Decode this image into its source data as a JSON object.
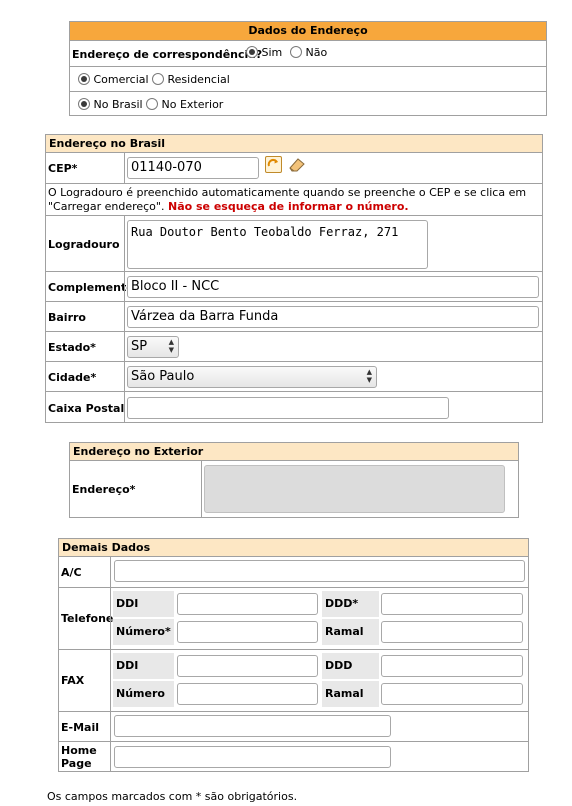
{
  "dados_endereco": {
    "title": "Dados do Endereço",
    "correspondencia_label": "Endereço de correspondência?",
    "sim": "Sim",
    "nao": "Não",
    "comercial": "Comercial",
    "residencial": "Residencial",
    "no_brasil": "No Brasil",
    "no_exterior": "No Exterior"
  },
  "endereco_brasil": {
    "title": "Endereço no Brasil",
    "cep_label": "CEP*",
    "cep_value": "01140-070",
    "info_text": "O Logradouro é preenchido automaticamente quando se preenche o CEP e se clica em \"Carregar endereço\".",
    "info_warning": "Não se esqueça de informar o número.",
    "logradouro_label": "Logradouro",
    "logradouro_value": "Rua Doutor Bento Teobaldo Ferraz, 271",
    "complemento_label": "Complemento",
    "complemento_value": "Bloco II - NCC",
    "bairro_label": "Bairro",
    "bairro_value": "Várzea da Barra Funda",
    "estado_label": "Estado*",
    "estado_value": "SP",
    "cidade_label": "Cidade*",
    "cidade_value": "São Paulo",
    "caixa_postal_label": "Caixa Postal",
    "caixa_postal_value": ""
  },
  "endereco_exterior": {
    "title": "Endereço no Exterior",
    "endereco_label": "Endereço*",
    "endereco_value": ""
  },
  "demais_dados": {
    "title": "Demais Dados",
    "ac_label": "A/C",
    "telefone_label": "Telefone",
    "fax_label": "FAX",
    "ddi_label": "DDI",
    "ddd_req_label": "DDD*",
    "ddd_label": "DDD",
    "numero_req_label": "Número*",
    "numero_label": "Número",
    "ramal_label": "Ramal",
    "email_label": "E-Mail",
    "homepage_label": "Home Page"
  },
  "footer_note": "Os campos marcados com * são obrigatórios.",
  "colors": {
    "header_orange": "#f7a73c",
    "header_light": "#fde7c4",
    "warning_red": "#cc0000"
  }
}
